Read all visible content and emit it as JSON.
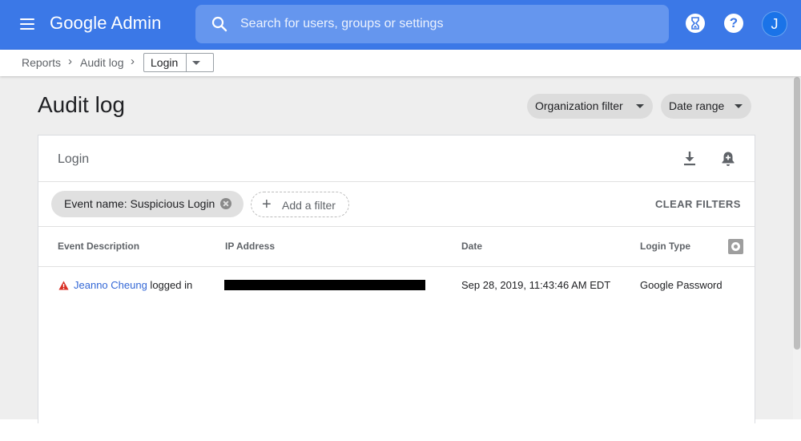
{
  "colors": {
    "topbar": "#3b78e7",
    "search_bg": "#6596ee",
    "link": "#3367d6",
    "warning": "#d93025",
    "content_bg": "#eeeeee"
  },
  "topbar": {
    "brand_google": "Google",
    "brand_admin": "Admin",
    "search_placeholder": "Search for users, groups or settings",
    "icons": [
      "menu-icon",
      "search-icon",
      "hourglass-icon",
      "help-icon"
    ],
    "help_glyph": "?",
    "avatar_initial": "J"
  },
  "breadcrumb": {
    "items": [
      "Reports",
      "Audit log"
    ],
    "separator": "›",
    "current": "Login"
  },
  "page": {
    "title": "Audit log",
    "org_filter_label": "Organization filter",
    "date_range_label": "Date range"
  },
  "card": {
    "title": "Login",
    "icons": [
      "download-icon",
      "add-alert-icon"
    ],
    "filter_chip": "Event name: Suspicious Login",
    "add_filter": "Add a filter",
    "clear_filters": "CLEAR FILTERS",
    "columns": [
      "Event Description",
      "IP Address",
      "Date",
      "Login Type"
    ],
    "rows": [
      {
        "user": "Jeanno Cheung",
        "action": " logged in",
        "ip_redacted": true,
        "date": "Sep 28, 2019, 11:43:46 AM EDT",
        "login_type": "Google Password"
      }
    ]
  }
}
